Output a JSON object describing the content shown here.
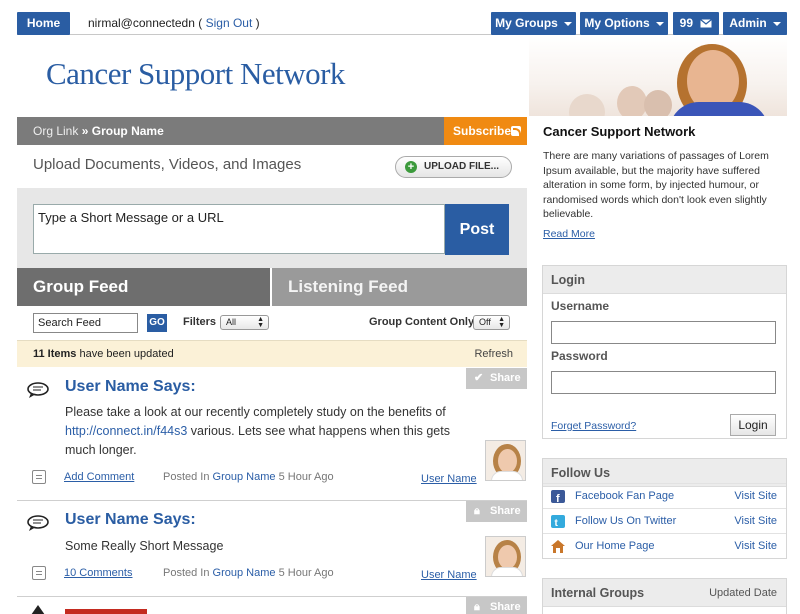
{
  "topbar": {
    "home": "Home",
    "user_email": "nirmal@connectedn",
    "sign_out_open": "(",
    "sign_out": "Sign Out",
    "sign_out_close": ")",
    "my_groups": "My Groups",
    "my_options": "My Options",
    "message_count": "99",
    "admin": "Admin"
  },
  "header": {
    "logo": "Cancer Support Network"
  },
  "breadcrumb": {
    "org_link": "Org Link",
    "separator": "»",
    "group_name": "Group Name",
    "subscribe": "Subscribe"
  },
  "upload": {
    "title": "Upload Documents, Videos, and Images",
    "button": "UPLOAD FILE..."
  },
  "composer": {
    "placeholder": "Type a Short Message or a URL",
    "post": "Post"
  },
  "tabs": {
    "group_feed": "Group Feed",
    "listening_feed": "Listening Feed"
  },
  "filters": {
    "search_value": "Search Feed",
    "go": "GO",
    "filters_label": "Filters",
    "filters_value": "All",
    "group_content_label": "Group Content Only",
    "group_content_value": "Off"
  },
  "updates": {
    "count": "11 Items",
    "text": "have been updated",
    "refresh": "Refresh"
  },
  "posts": [
    {
      "author": "User Name Says:",
      "body_pre": "Please take a look at our recently completely study on the benefits of",
      "link": "http://connect.in/f44s3",
      "body_post": "various. Lets see what happens when this gets much longer.",
      "share": "Share",
      "comment_link": "Add Comment",
      "posted_in": "Posted In",
      "group": "Group Name",
      "time": "5 Hour Ago",
      "user": "User Name"
    },
    {
      "author": "User Name Says:",
      "body": "Some Really Short Message",
      "share": "Share",
      "comment_link": "10 Comments",
      "posted_in": "Posted In",
      "group": "Group Name",
      "time": "5 Hour Ago",
      "user": "User Name"
    },
    {
      "share": "Share"
    }
  ],
  "about": {
    "title": "Cancer Support Network",
    "text": "There are many variations of passages of Lorem Ipsum available, but the majority have suffered alteration in some form, by injected humour, or randomised words which don't look even slightly believable.",
    "read_more": "Read More"
  },
  "login": {
    "title": "Login",
    "username": "Username",
    "password": "Password",
    "forgot": "Forget Password?",
    "button": "Login"
  },
  "follow": {
    "title": "Follow Us",
    "items": [
      {
        "label": "Facebook Fan Page",
        "visit": "Visit Site",
        "icon": "facebook-icon"
      },
      {
        "label": "Follow Us On Twitter",
        "visit": "Visit Site",
        "icon": "twitter-icon"
      },
      {
        "label": "Our Home Page",
        "visit": "Visit Site",
        "icon": "home-icon"
      }
    ]
  },
  "internal_groups": {
    "title": "Internal Groups",
    "updated": "Updated Date"
  },
  "colors": {
    "brand_blue": "#2a5da3",
    "subscribe_orange": "#f08a12",
    "tab_dark": "#6e6e6e",
    "tab_light": "#9a9a9a"
  }
}
